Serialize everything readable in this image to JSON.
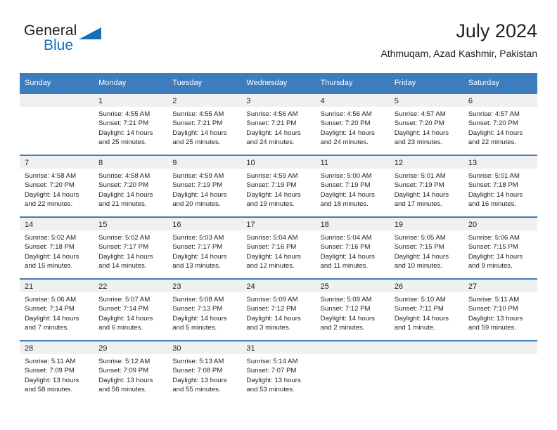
{
  "logo": {
    "word1": "General",
    "word2": "Blue",
    "triangle_color": "#1271bd"
  },
  "header": {
    "title": "July 2024",
    "subtitle": "Athmuqam, Azad Kashmir, Pakistan"
  },
  "theme": {
    "header_bg": "#3d7cbd",
    "daynum_bg": "#f0f0f0",
    "text": "#231f20"
  },
  "weekdays": [
    "Sunday",
    "Monday",
    "Tuesday",
    "Wednesday",
    "Thursday",
    "Friday",
    "Saturday"
  ],
  "weeks": [
    [
      {
        "day": "",
        "lines": []
      },
      {
        "day": "1",
        "lines": [
          "Sunrise: 4:55 AM",
          "Sunset: 7:21 PM",
          "Daylight: 14 hours",
          "and 25 minutes."
        ]
      },
      {
        "day": "2",
        "lines": [
          "Sunrise: 4:55 AM",
          "Sunset: 7:21 PM",
          "Daylight: 14 hours",
          "and 25 minutes."
        ]
      },
      {
        "day": "3",
        "lines": [
          "Sunrise: 4:56 AM",
          "Sunset: 7:21 PM",
          "Daylight: 14 hours",
          "and 24 minutes."
        ]
      },
      {
        "day": "4",
        "lines": [
          "Sunrise: 4:56 AM",
          "Sunset: 7:20 PM",
          "Daylight: 14 hours",
          "and 24 minutes."
        ]
      },
      {
        "day": "5",
        "lines": [
          "Sunrise: 4:57 AM",
          "Sunset: 7:20 PM",
          "Daylight: 14 hours",
          "and 23 minutes."
        ]
      },
      {
        "day": "6",
        "lines": [
          "Sunrise: 4:57 AM",
          "Sunset: 7:20 PM",
          "Daylight: 14 hours",
          "and 22 minutes."
        ]
      }
    ],
    [
      {
        "day": "7",
        "lines": [
          "Sunrise: 4:58 AM",
          "Sunset: 7:20 PM",
          "Daylight: 14 hours",
          "and 22 minutes."
        ]
      },
      {
        "day": "8",
        "lines": [
          "Sunrise: 4:58 AM",
          "Sunset: 7:20 PM",
          "Daylight: 14 hours",
          "and 21 minutes."
        ]
      },
      {
        "day": "9",
        "lines": [
          "Sunrise: 4:59 AM",
          "Sunset: 7:19 PM",
          "Daylight: 14 hours",
          "and 20 minutes."
        ]
      },
      {
        "day": "10",
        "lines": [
          "Sunrise: 4:59 AM",
          "Sunset: 7:19 PM",
          "Daylight: 14 hours",
          "and 19 minutes."
        ]
      },
      {
        "day": "11",
        "lines": [
          "Sunrise: 5:00 AM",
          "Sunset: 7:19 PM",
          "Daylight: 14 hours",
          "and 18 minutes."
        ]
      },
      {
        "day": "12",
        "lines": [
          "Sunrise: 5:01 AM",
          "Sunset: 7:19 PM",
          "Daylight: 14 hours",
          "and 17 minutes."
        ]
      },
      {
        "day": "13",
        "lines": [
          "Sunrise: 5:01 AM",
          "Sunset: 7:18 PM",
          "Daylight: 14 hours",
          "and 16 minutes."
        ]
      }
    ],
    [
      {
        "day": "14",
        "lines": [
          "Sunrise: 5:02 AM",
          "Sunset: 7:18 PM",
          "Daylight: 14 hours",
          "and 15 minutes."
        ]
      },
      {
        "day": "15",
        "lines": [
          "Sunrise: 5:02 AM",
          "Sunset: 7:17 PM",
          "Daylight: 14 hours",
          "and 14 minutes."
        ]
      },
      {
        "day": "16",
        "lines": [
          "Sunrise: 5:03 AM",
          "Sunset: 7:17 PM",
          "Daylight: 14 hours",
          "and 13 minutes."
        ]
      },
      {
        "day": "17",
        "lines": [
          "Sunrise: 5:04 AM",
          "Sunset: 7:16 PM",
          "Daylight: 14 hours",
          "and 12 minutes."
        ]
      },
      {
        "day": "18",
        "lines": [
          "Sunrise: 5:04 AM",
          "Sunset: 7:16 PM",
          "Daylight: 14 hours",
          "and 11 minutes."
        ]
      },
      {
        "day": "19",
        "lines": [
          "Sunrise: 5:05 AM",
          "Sunset: 7:15 PM",
          "Daylight: 14 hours",
          "and 10 minutes."
        ]
      },
      {
        "day": "20",
        "lines": [
          "Sunrise: 5:06 AM",
          "Sunset: 7:15 PM",
          "Daylight: 14 hours",
          "and 9 minutes."
        ]
      }
    ],
    [
      {
        "day": "21",
        "lines": [
          "Sunrise: 5:06 AM",
          "Sunset: 7:14 PM",
          "Daylight: 14 hours",
          "and 7 minutes."
        ]
      },
      {
        "day": "22",
        "lines": [
          "Sunrise: 5:07 AM",
          "Sunset: 7:14 PM",
          "Daylight: 14 hours",
          "and 6 minutes."
        ]
      },
      {
        "day": "23",
        "lines": [
          "Sunrise: 5:08 AM",
          "Sunset: 7:13 PM",
          "Daylight: 14 hours",
          "and 5 minutes."
        ]
      },
      {
        "day": "24",
        "lines": [
          "Sunrise: 5:09 AM",
          "Sunset: 7:12 PM",
          "Daylight: 14 hours",
          "and 3 minutes."
        ]
      },
      {
        "day": "25",
        "lines": [
          "Sunrise: 5:09 AM",
          "Sunset: 7:12 PM",
          "Daylight: 14 hours",
          "and 2 minutes."
        ]
      },
      {
        "day": "26",
        "lines": [
          "Sunrise: 5:10 AM",
          "Sunset: 7:11 PM",
          "Daylight: 14 hours",
          "and 1 minute."
        ]
      },
      {
        "day": "27",
        "lines": [
          "Sunrise: 5:11 AM",
          "Sunset: 7:10 PM",
          "Daylight: 13 hours",
          "and 59 minutes."
        ]
      }
    ],
    [
      {
        "day": "28",
        "lines": [
          "Sunrise: 5:11 AM",
          "Sunset: 7:09 PM",
          "Daylight: 13 hours",
          "and 58 minutes."
        ]
      },
      {
        "day": "29",
        "lines": [
          "Sunrise: 5:12 AM",
          "Sunset: 7:09 PM",
          "Daylight: 13 hours",
          "and 56 minutes."
        ]
      },
      {
        "day": "30",
        "lines": [
          "Sunrise: 5:13 AM",
          "Sunset: 7:08 PM",
          "Daylight: 13 hours",
          "and 55 minutes."
        ]
      },
      {
        "day": "31",
        "lines": [
          "Sunrise: 5:14 AM",
          "Sunset: 7:07 PM",
          "Daylight: 13 hours",
          "and 53 minutes."
        ]
      },
      {
        "day": "",
        "lines": []
      },
      {
        "day": "",
        "lines": []
      },
      {
        "day": "",
        "lines": []
      }
    ]
  ]
}
